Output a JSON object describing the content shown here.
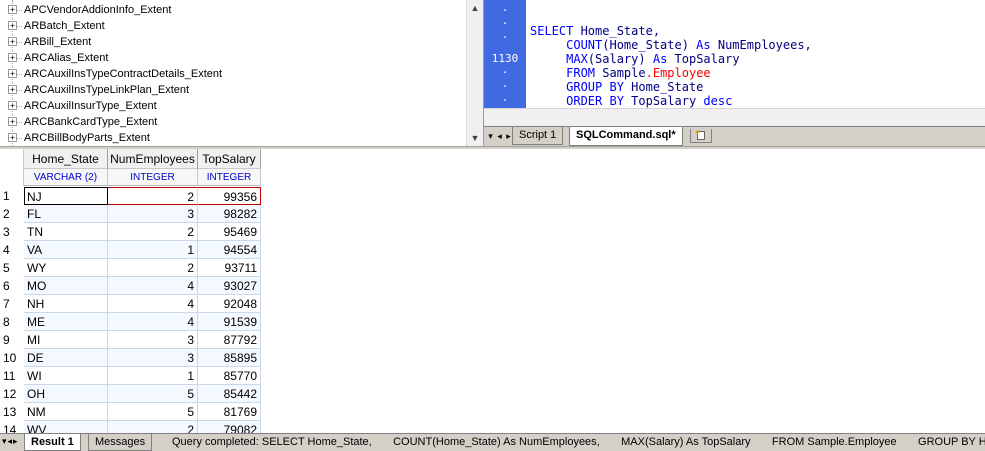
{
  "tree": {
    "items": [
      "APCVendorAddionInfo_Extent",
      "ARBatch_Extent",
      "ARBill_Extent",
      "ARCAlias_Extent",
      "ARCAuxilInsTypeContractDetails_Extent",
      "ARCAuxilInsTypeLinkPlan_Extent",
      "ARCAuxilInsurType_Extent",
      "ARCBankCardType_Extent",
      "ARCBillBodyParts_Extent"
    ],
    "expander_glyph": "+"
  },
  "editor": {
    "line_number": "1130",
    "gutter_dot": "·",
    "lines": [
      "SELECT Home_State,",
      "     COUNT(Home_State) As NumEmployees,",
      "     MAX(Salary) As TopSalary",
      "     FROM Sample.Employee",
      "     GROUP BY Home_State",
      "     ORDER BY TopSalary desc"
    ],
    "tokens": {
      "l1_kw": "SELECT",
      "l1_rest": " Home_State,",
      "l2_fn": "COUNT",
      "l2_rest1": "(Home_State) ",
      "l2_as": "As",
      "l2_rest2": " NumEmployees,",
      "l3_fn": "MAX",
      "l3_rest1": "(Salary) ",
      "l3_as": "As",
      "l3_rest2": " TopSalary",
      "l4_kw": "FROM",
      "l4_schema": " Sample",
      "l4_dot": ".",
      "l4_table": "Employee",
      "l5_kw": "GROUP BY",
      "l5_rest": " Home_State",
      "l6_kw": "ORDER BY",
      "l6_rest": " TopSalary ",
      "l6_desc": "desc"
    }
  },
  "editor_tabs": {
    "nav": [
      "▾",
      "◂",
      "▸"
    ],
    "tabs": [
      {
        "label": "Script 1",
        "active": false
      },
      {
        "label": "SQLCommand.sql*",
        "active": true
      }
    ]
  },
  "grid": {
    "columns": [
      {
        "name": "Home_State",
        "type": "VARCHAR (2)"
      },
      {
        "name": "NumEmployees",
        "type": "INTEGER"
      },
      {
        "name": "TopSalary",
        "type": "INTEGER"
      }
    ],
    "rows": [
      [
        "1",
        "NJ",
        "2",
        "99356"
      ],
      [
        "2",
        "FL",
        "3",
        "98282"
      ],
      [
        "3",
        "TN",
        "2",
        "95469"
      ],
      [
        "4",
        "VA",
        "1",
        "94554"
      ],
      [
        "5",
        "WY",
        "2",
        "93711"
      ],
      [
        "6",
        "MO",
        "4",
        "93027"
      ],
      [
        "7",
        "NH",
        "4",
        "92048"
      ],
      [
        "8",
        "ME",
        "4",
        "91539"
      ],
      [
        "9",
        "MI",
        "3",
        "87792"
      ],
      [
        "10",
        "DE",
        "3",
        "85895"
      ],
      [
        "11",
        "WI",
        "1",
        "85770"
      ],
      [
        "12",
        "OH",
        "5",
        "85442"
      ],
      [
        "13",
        "NM",
        "5",
        "81769"
      ],
      [
        "14",
        "WV",
        "2",
        "79082"
      ]
    ]
  },
  "statusbar": {
    "nav": "▾◂▸",
    "tabs": [
      {
        "label": "Result 1",
        "active": true
      },
      {
        "label": "Messages",
        "active": false
      }
    ],
    "message": "Query completed: SELECT Home_State,       COUNT(Home_State) As NumEmployees,       MAX(Salary) As TopSalary       FROM Sample.Employee       GROUP BY Home_St"
  },
  "colors": {
    "gutter": "#4169e1",
    "keyword": "#0000ff",
    "identifier": "#000080",
    "table_name": "#ff0000",
    "type_header": "#0000cd",
    "selection_border": "#c00000"
  }
}
